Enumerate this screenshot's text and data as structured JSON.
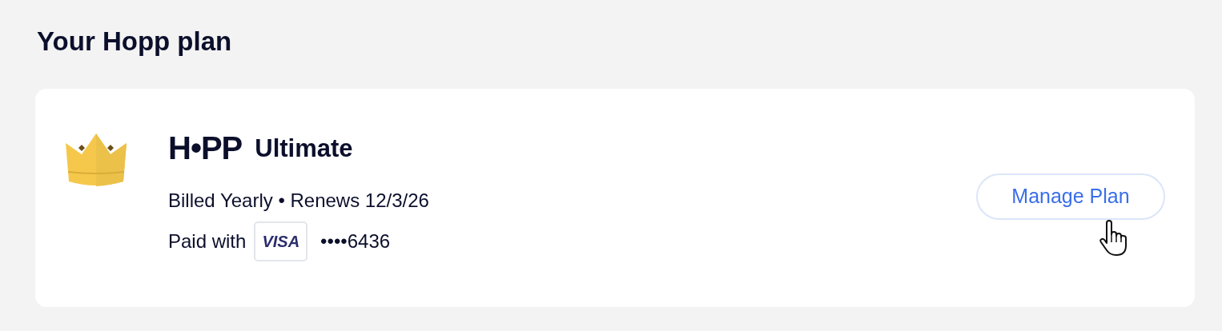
{
  "heading": "Your Hopp plan",
  "plan": {
    "logo": "H•PP",
    "name": "Ultimate",
    "billing": "Billed Yearly • Renews 12/3/26",
    "paid_label": "Paid with",
    "card_brand": "VISA",
    "card_number": "••••6436"
  },
  "button": {
    "label": "Manage Plan"
  }
}
